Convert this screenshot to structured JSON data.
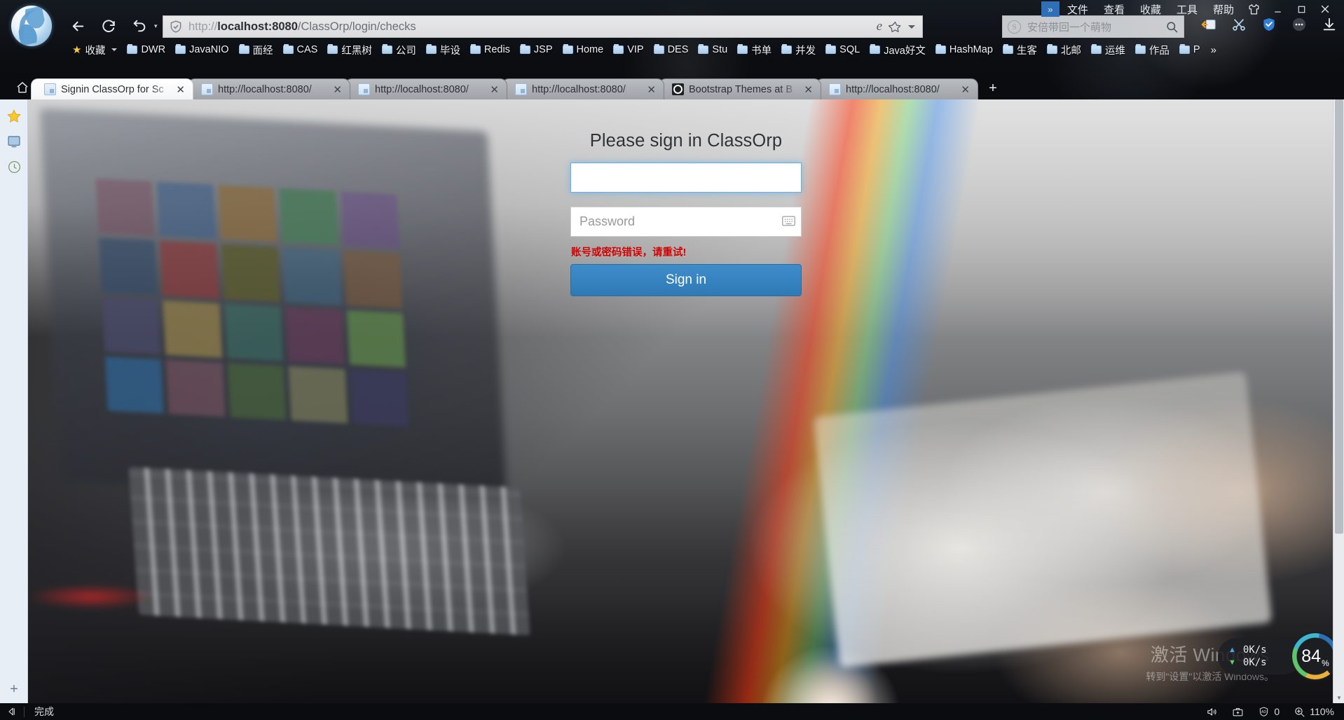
{
  "window": {
    "menu_items": [
      "文件",
      "查看",
      "收藏",
      "工具",
      "帮助"
    ],
    "chevron": "»",
    "skin_icon": "shirt-icon",
    "minimize": "—",
    "maximize": "□",
    "close": "✕"
  },
  "nav": {
    "back": "back-arrow-icon",
    "refresh": "refresh-icon",
    "undo": "undo-icon",
    "caret": "▾"
  },
  "address": {
    "security_icon": "shield-check-icon",
    "url_scheme": "http://",
    "url_host": "localhost:8080",
    "url_path": "/ClassOrp/login/checks",
    "full_url": "http://localhost:8080/ClassOrp/login/checks",
    "ie_mode_icon": "ie-compat-icon",
    "bookmark_star": "star-outline-icon",
    "dropdown": "chevron-down-icon"
  },
  "search": {
    "engine_logo": "sogou-s-icon",
    "value": "安倍带回一个萌物",
    "search_icon": "magnifier-icon"
  },
  "toolbar_icons": [
    "window-capture-icon",
    "scissors-icon",
    "wps-shield-icon",
    "more-dots-icon",
    "download-icon"
  ],
  "bookmarks": {
    "star_label": "收藏",
    "items": [
      "DWR",
      "JavaNIO",
      "面经",
      "CAS",
      "红黑树",
      "公司",
      "毕设",
      "Redis",
      "JSP",
      "Home",
      "VIP",
      "DES",
      "Stu",
      "书单",
      "并发",
      "SQL",
      "Java好文",
      "HashMap",
      "生客",
      "北邮",
      "运维",
      "作品",
      "P"
    ],
    "overflow": "»"
  },
  "tabs": {
    "home_icon": "home-icon",
    "new_tab": "+",
    "items": [
      {
        "title": "Signin ClassOrp for Sc",
        "favicon": "page-icon",
        "active": true
      },
      {
        "title": "http://localhost:8080/",
        "favicon": "page-icon",
        "active": false
      },
      {
        "title": "http://localhost:8080/",
        "favicon": "page-icon",
        "active": false
      },
      {
        "title": "http://localhost:8080/",
        "favicon": "page-icon",
        "active": false
      },
      {
        "title": "Bootstrap Themes at B",
        "favicon": "bootstrap-icon",
        "active": false
      },
      {
        "title": "http://localhost:8080/",
        "favicon": "page-icon",
        "active": false
      }
    ]
  },
  "rail": {
    "items": [
      "favorites-star-icon",
      "screenshot-icon",
      "history-clock-icon"
    ],
    "add": "+"
  },
  "login": {
    "title": "Please sign in ClassOrp",
    "username_value": "",
    "username_placeholder": "",
    "password_value": "",
    "password_placeholder": "Password",
    "keyboard_icon": "soft-keyboard-icon",
    "error_message": "账号或密码错误，请重试!",
    "submit_label": "Sign in",
    "accent_color": "#3276b1",
    "error_color": "#cc0000",
    "focus_color": "#66afe9"
  },
  "watermark": {
    "line1": "激活 Windows",
    "line2": "转到\"设置\"以激活 Windows。"
  },
  "speed_widget": {
    "up_arrow": "▲",
    "up_value": "0K/s",
    "down_arrow": "▼",
    "down_value": "0K/s",
    "cpu_number": "84",
    "cpu_unit": "%"
  },
  "status_bar": {
    "back_icon": "collapse-left-icon",
    "text": "完成",
    "sound_icon": "speaker-icon",
    "toolbox_icon": "toolbox-icon",
    "ad_icon": "ad-block-icon",
    "ad_count": "0",
    "zoom_icon": "zoom-icon",
    "zoom_level": "110%"
  },
  "thumb_colors": [
    "#7a4a5e",
    "#3f5f8a",
    "#8a6a3a",
    "#4a7a5a",
    "#6a4a8a",
    "#2f4a6a",
    "#8a3a3a",
    "#5a5a2f",
    "#3a6a8a",
    "#7a5a3a",
    "#4a4a6a",
    "#8a7a4a",
    "#3a7a6a",
    "#6a3a5a",
    "#5f8a4a",
    "#2f5f8a",
    "#8a5a6a",
    "#4a6a3a",
    "#7a7a5a",
    "#3a3a5a"
  ]
}
